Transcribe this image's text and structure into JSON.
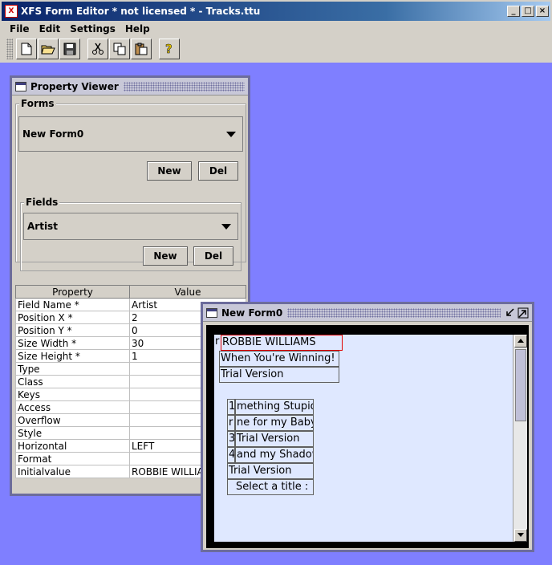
{
  "window": {
    "title": "XFS Form Editor * not licensed * - Tracks.ttu"
  },
  "menu": [
    {
      "label": "File",
      "u": "F"
    },
    {
      "label": "Edit",
      "u": "E"
    },
    {
      "label": "Settings",
      "u": "S"
    },
    {
      "label": "Help",
      "u": "H"
    }
  ],
  "toolbar": {
    "icons": [
      "new-file-icon",
      "open-folder-icon",
      "save-icon",
      "cut-icon",
      "copy-icon",
      "paste-icon",
      "help-icon"
    ]
  },
  "property_viewer": {
    "title": "Property Viewer",
    "forms_label": "Forms",
    "forms_selected": "New Form0",
    "fields_label": "Fields",
    "fields_selected": "Artist",
    "new_label": "New",
    "del_label": "Del",
    "table": {
      "headers": [
        "Property",
        "Value"
      ],
      "rows": [
        [
          "Field Name *",
          "Artist"
        ],
        [
          "Position X *",
          "2"
        ],
        [
          "Position Y *",
          "0"
        ],
        [
          "Size Width *",
          "30"
        ],
        [
          "Size Height *",
          "1"
        ],
        [
          "Type",
          ""
        ],
        [
          "Class",
          ""
        ],
        [
          "Keys",
          ""
        ],
        [
          "Access",
          ""
        ],
        [
          "Overflow",
          ""
        ],
        [
          "Style",
          ""
        ],
        [
          "Horizontal",
          "LEFT"
        ],
        [
          "Format",
          ""
        ],
        [
          "Initialvalue",
          "ROBBIE WILLIA"
        ]
      ]
    }
  },
  "form_window": {
    "title": "New Form0",
    "fields": {
      "f1_prefix": "r",
      "f1": "ROBBIE WILLIAMS",
      "f2": "When You're Winning!",
      "f3": "Trial Version",
      "r1n": "1",
      "r1": "mething Stupid",
      "r2n": "r",
      "r2": "ne for my Baby",
      "r3n": "3",
      "r3": "Trial Version",
      "r4n": "4",
      "r4": "and my Shadow",
      "r5": "Trial Version",
      "r6": "Select a title :"
    }
  }
}
